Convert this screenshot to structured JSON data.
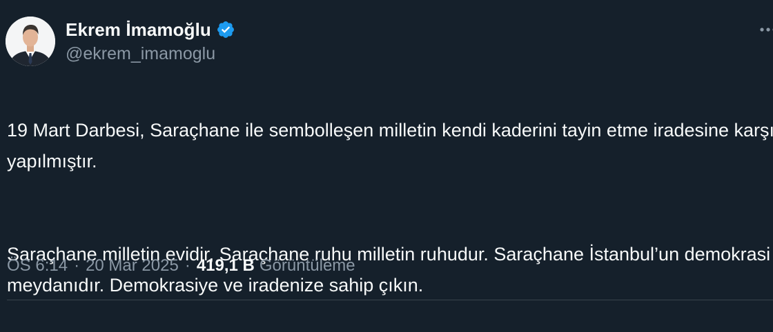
{
  "author": {
    "display_name": "Ekrem İmamoğlu",
    "handle": "@ekrem_imamoglu",
    "verified": true,
    "verified_color": "#1d9bf0",
    "avatar_icon": "profile-photo"
  },
  "tweet": {
    "paragraphs": [
      "19 Mart Darbesi, Saraçhane ile sembolleşen milletin kendi kaderini tayin etme iradesine karşı yapılmıştır.",
      "Saraçhane milletin evidir, Saraçhane ruhu milletin ruhudur. Saraçhane İstanbul’un demokrasi meydanıdır. Demokrasiye ve iradenize sahip çıkın."
    ]
  },
  "meta": {
    "time": "ÖS 6:14",
    "separator": "·",
    "date": "20 Mar 2025",
    "views_count": "419,1 B",
    "views_label": "Görüntüleme"
  },
  "colors": {
    "background": "#15202b",
    "text_primary": "#f7f9f9",
    "text_secondary": "#8b98a5",
    "divider": "#38444d"
  }
}
